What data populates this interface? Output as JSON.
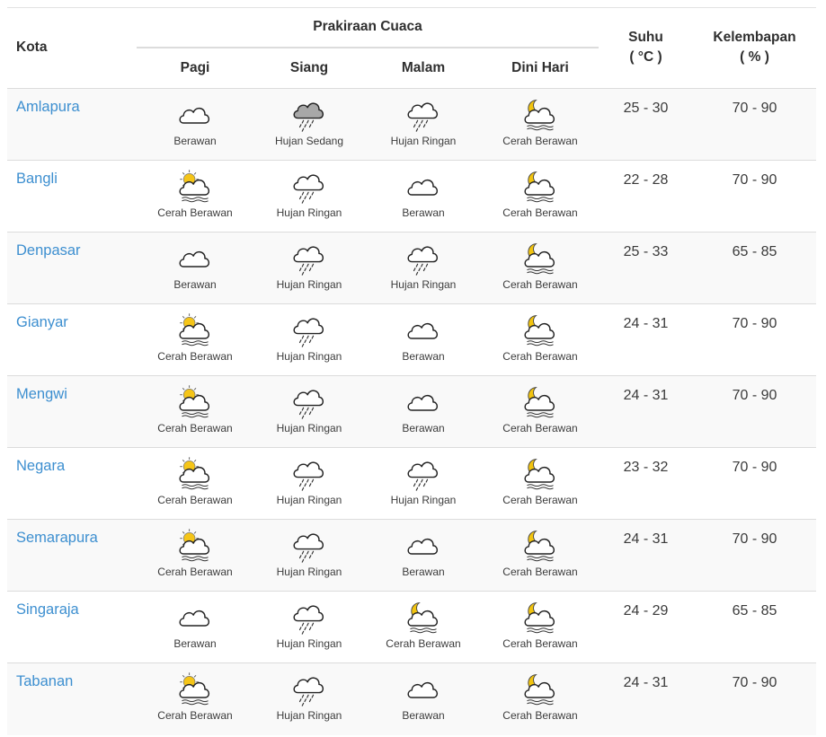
{
  "header": {
    "kota": "Kota",
    "forecast_group": "Prakiraan Cuaca",
    "periods": [
      "Pagi",
      "Siang",
      "Malam",
      "Dini Hari"
    ],
    "suhu": "Suhu",
    "suhu_unit": "( °C )",
    "kelembapan": "Kelembapan",
    "kelembapan_unit": "( % )"
  },
  "rows": [
    {
      "city": "Amlapura",
      "suhu": "25 - 30",
      "kelembapan": "70 - 90",
      "periods": [
        {
          "icon": "cloudy-icon",
          "label": "Berawan"
        },
        {
          "icon": "moderate-rain-icon",
          "label": "Hujan Sedang"
        },
        {
          "icon": "light-rain-icon",
          "label": "Hujan Ringan"
        },
        {
          "icon": "moon-cloud-icon",
          "label": "Cerah Berawan"
        }
      ]
    },
    {
      "city": "Bangli",
      "suhu": "22 - 28",
      "kelembapan": "70 - 90",
      "periods": [
        {
          "icon": "sun-cloud-icon",
          "label": "Cerah Berawan"
        },
        {
          "icon": "light-rain-icon",
          "label": "Hujan Ringan"
        },
        {
          "icon": "cloudy-icon",
          "label": "Berawan"
        },
        {
          "icon": "moon-cloud-icon",
          "label": "Cerah Berawan"
        }
      ]
    },
    {
      "city": "Denpasar",
      "suhu": "25 - 33",
      "kelembapan": "65 - 85",
      "periods": [
        {
          "icon": "cloudy-icon",
          "label": "Berawan"
        },
        {
          "icon": "light-rain-icon",
          "label": "Hujan Ringan"
        },
        {
          "icon": "light-rain-icon",
          "label": "Hujan Ringan"
        },
        {
          "icon": "moon-cloud-icon",
          "label": "Cerah Berawan"
        }
      ]
    },
    {
      "city": "Gianyar",
      "suhu": "24 - 31",
      "kelembapan": "70 - 90",
      "periods": [
        {
          "icon": "sun-cloud-icon",
          "label": "Cerah Berawan"
        },
        {
          "icon": "light-rain-icon",
          "label": "Hujan Ringan"
        },
        {
          "icon": "cloudy-icon",
          "label": "Berawan"
        },
        {
          "icon": "moon-cloud-icon",
          "label": "Cerah Berawan"
        }
      ]
    },
    {
      "city": "Mengwi",
      "suhu": "24 - 31",
      "kelembapan": "70 - 90",
      "periods": [
        {
          "icon": "sun-cloud-icon",
          "label": "Cerah Berawan"
        },
        {
          "icon": "light-rain-icon",
          "label": "Hujan Ringan"
        },
        {
          "icon": "cloudy-icon",
          "label": "Berawan"
        },
        {
          "icon": "moon-cloud-icon",
          "label": "Cerah Berawan"
        }
      ]
    },
    {
      "city": "Negara",
      "suhu": "23 - 32",
      "kelembapan": "70 - 90",
      "periods": [
        {
          "icon": "sun-cloud-icon",
          "label": "Cerah Berawan"
        },
        {
          "icon": "light-rain-icon",
          "label": "Hujan Ringan"
        },
        {
          "icon": "light-rain-icon",
          "label": "Hujan Ringan"
        },
        {
          "icon": "moon-cloud-icon",
          "label": "Cerah Berawan"
        }
      ]
    },
    {
      "city": "Semarapura",
      "suhu": "24 - 31",
      "kelembapan": "70 - 90",
      "periods": [
        {
          "icon": "sun-cloud-icon",
          "label": "Cerah Berawan"
        },
        {
          "icon": "light-rain-icon",
          "label": "Hujan Ringan"
        },
        {
          "icon": "cloudy-icon",
          "label": "Berawan"
        },
        {
          "icon": "moon-cloud-icon",
          "label": "Cerah Berawan"
        }
      ]
    },
    {
      "city": "Singaraja",
      "suhu": "24 - 29",
      "kelembapan": "65 - 85",
      "periods": [
        {
          "icon": "cloudy-icon",
          "label": "Berawan"
        },
        {
          "icon": "light-rain-icon",
          "label": "Hujan Ringan"
        },
        {
          "icon": "moon-cloud-icon",
          "label": "Cerah Berawan"
        },
        {
          "icon": "moon-cloud-icon",
          "label": "Cerah Berawan"
        }
      ]
    },
    {
      "city": "Tabanan",
      "suhu": "24 - 31",
      "kelembapan": "70 - 90",
      "periods": [
        {
          "icon": "sun-cloud-icon",
          "label": "Cerah Berawan"
        },
        {
          "icon": "light-rain-icon",
          "label": "Hujan Ringan"
        },
        {
          "icon": "cloudy-icon",
          "label": "Berawan"
        },
        {
          "icon": "moon-cloud-icon",
          "label": "Cerah Berawan"
        }
      ]
    }
  ],
  "colors": {
    "city_link": "#3d8fd0",
    "sun": "#f5c518",
    "moon": "#f2c40f",
    "rain_cloud": "#a8a8a8",
    "row_alt": "#f9f9f9",
    "border": "#dcdcdc"
  }
}
